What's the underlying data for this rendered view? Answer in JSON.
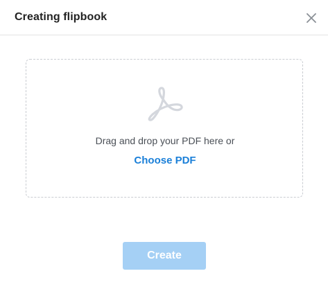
{
  "dialog": {
    "title": "Creating flipbook",
    "close_icon": "close-icon"
  },
  "dropzone": {
    "icon": "pdf-icon",
    "instruction": "Drag and drop your PDF here or",
    "choose_label": "Choose PDF"
  },
  "footer": {
    "create_label": "Create",
    "create_state": "disabled"
  },
  "colors": {
    "link": "#1a7fd8",
    "button_disabled": "#a5d0f5",
    "icon": "#d4d7dd",
    "border": "#c9ccd1"
  }
}
